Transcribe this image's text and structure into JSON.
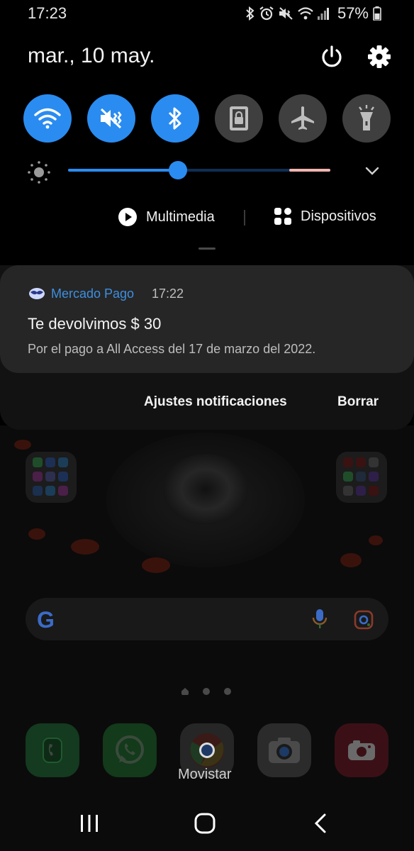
{
  "status_bar": {
    "time": "17:23",
    "battery": "57%",
    "icons": [
      "bluetooth-icon",
      "alarm-icon",
      "vibrate-icon",
      "wifi-icon",
      "signal-icon",
      "battery-icon"
    ]
  },
  "quick_panel": {
    "date": "mar., 10 may.",
    "tiles": [
      {
        "name": "wifi",
        "icon": "wifi-icon",
        "active": true
      },
      {
        "name": "sound",
        "icon": "vibrate-icon",
        "active": true
      },
      {
        "name": "bluetooth",
        "icon": "bluetooth-icon",
        "active": true
      },
      {
        "name": "rotation-lock",
        "icon": "lock-icon",
        "active": false
      },
      {
        "name": "airplane",
        "icon": "airplane-icon",
        "active": false
      },
      {
        "name": "flashlight",
        "icon": "flashlight-icon",
        "active": false
      }
    ],
    "brightness": 0.42,
    "media_label": "Multimedia",
    "devices_label": "Dispositivos"
  },
  "notification": {
    "app_name": "Mercado Pago",
    "time": "17:22",
    "title": "Te devolvimos $ 30",
    "body": "Por el pago a All Access del 17 de marzo del 2022.",
    "settings_label": "Ajustes notificaciones",
    "clear_label": "Borrar"
  },
  "home": {
    "dock_label": "Movistar",
    "search_logo": "G"
  },
  "colors": {
    "accent": "#2a8cf0",
    "tile_off": "#3f3f3f",
    "notification_app": "#3d8fe0"
  }
}
